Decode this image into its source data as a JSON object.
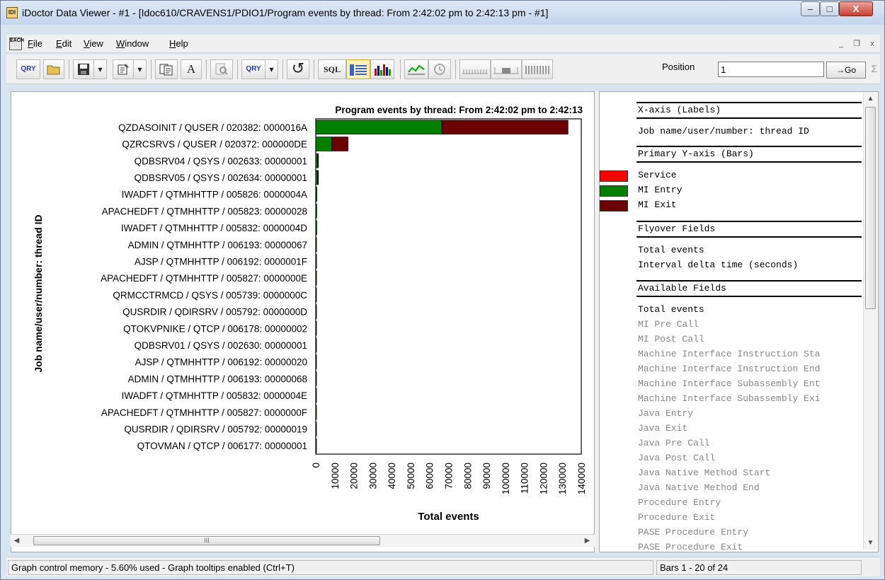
{
  "window": {
    "title": "iDoctor Data Viewer - #1 - [Idoc610/CRAVENS1/PDIO1/Program events by thread: From 2:42:02 pm to 2:42:13 pm - #1]",
    "icon_text": "IDI",
    "min_glyph": "–",
    "max_glyph": "□",
    "close_glyph": "X"
  },
  "menu": {
    "mdi_icon_text": "EACH",
    "items": [
      "File",
      "Edit",
      "View",
      "Window",
      "Help"
    ],
    "mdi_min": "_",
    "mdi_restore": "❐",
    "mdi_close": "x"
  },
  "toolbar": {
    "qry_label": "QRY",
    "qry2_label": "QRY",
    "sql_label": "SQL",
    "font_label": "A",
    "refresh_glyph": "↺",
    "dropdown_glyph": "▾",
    "position_label": "Position",
    "position_value": "1",
    "go_label": "→Go",
    "sigma_glyph": "Σ"
  },
  "chart_data": {
    "type": "bar",
    "orientation": "horizontal",
    "stacked": true,
    "title": "Program events by thread: From 2:42:02 pm to 2:42:13",
    "xlabel": "Total events",
    "ylabel": "Job name/user/number: thread ID",
    "xlim": [
      0,
      140000
    ],
    "xticks": [
      0,
      10000,
      20000,
      30000,
      40000,
      50000,
      60000,
      70000,
      80000,
      90000,
      100000,
      110000,
      120000,
      130000,
      140000
    ],
    "categories": [
      "QZDASOINIT / QUSER / 020382: 0000016A",
      "QZRCSRVS / QUSER / 020372: 000000DE",
      "QDBSRV04 / QSYS / 002633: 00000001",
      "QDBSRV05 / QSYS / 002634: 00000001",
      "IWADFT / QTMHHTTP / 005826: 0000004A",
      "APACHEDFT / QTMHHTTP / 005823: 00000028",
      "IWADFT / QTMHHTTP / 005832: 0000004D",
      "ADMIN / QTMHHTTP / 006193: 00000067",
      "AJSP / QTMHHTTP / 006192: 0000001F",
      "APACHEDFT / QTMHHTTP / 005827: 0000000E",
      "QRMCCTRMCD / QSYS / 005739: 0000000C",
      "QUSRDIR / QDIRSRV / 005792: 0000000D",
      "QTOKVPNIKE / QTCP / 006178: 00000002",
      "QDBSRV01 / QSYS / 002630: 00000001",
      "AJSP / QTMHHTTP / 006192: 00000020",
      "ADMIN / QTMHHTTP / 006193: 00000068",
      "IWADFT / QTMHHTTP / 005832: 0000004E",
      "APACHEDFT / QTMHHTTP / 005827: 0000000F",
      "QUSRDIR / QDIRSRV / 005792: 00000019",
      "QTOVMAN / QTCP / 006177: 00000001"
    ],
    "series": [
      {
        "name": "Service",
        "color": "#ff0000",
        "values": [
          0,
          0,
          0,
          0,
          0,
          0,
          0,
          0,
          0,
          0,
          0,
          0,
          0,
          0,
          0,
          0,
          0,
          0,
          0,
          0
        ]
      },
      {
        "name": "MI Entry",
        "color": "#007f00",
        "values": [
          66500,
          8500,
          1000,
          1000,
          600,
          500,
          500,
          400,
          400,
          400,
          300,
          300,
          200,
          200,
          200,
          200,
          150,
          150,
          100,
          100
        ]
      },
      {
        "name": "MI Exit",
        "color": "#6b0000",
        "values": [
          66500,
          8500,
          100,
          100,
          0,
          0,
          0,
          0,
          0,
          0,
          0,
          0,
          0,
          0,
          0,
          0,
          0,
          0,
          0,
          0
        ]
      }
    ],
    "grid": false,
    "legend": "right panel"
  },
  "right_panel": {
    "xaxis_header": "X-axis (Labels)",
    "xaxis_field": "Job name/user/number: thread ID",
    "yaxis_header": "Primary Y-axis (Bars)",
    "legend": [
      {
        "label": "Service",
        "color": "#ff0000"
      },
      {
        "label": "MI Entry",
        "color": "#007f00"
      },
      {
        "label": "MI Exit",
        "color": "#6b0000"
      }
    ],
    "flyover_header": "Flyover Fields",
    "flyover_fields": [
      "Total events",
      "Interval delta time (seconds)"
    ],
    "available_header": "Available Fields",
    "available_fields": [
      "Total events",
      "MI Pre Call",
      "MI Post Call",
      "Machine Interface Instruction Sta",
      "Machine Interface Instruction End",
      "Machine Interface Subassembly Ent",
      "Machine Interface Subassembly Exi",
      "Java Entry",
      "Java Exit",
      "Java Pre Call",
      "Java Post Call",
      "Java Native Method Start",
      "Java Native Method End",
      "Procedure Entry",
      "Procedure Exit",
      "PASE Procedure Entry",
      "PASE Procedure Exit"
    ]
  },
  "scrollbars": {
    "left_arrow": "◀",
    "right_arrow": "▶",
    "up_arrow": "▲",
    "down_arrow": "▼",
    "grip": "III",
    "vgrip": "≡"
  },
  "status": {
    "left": "Graph control memory - 5.60% used - Graph tooltips enabled (Ctrl+T)",
    "right": "Bars 1 - 20 of 24"
  }
}
